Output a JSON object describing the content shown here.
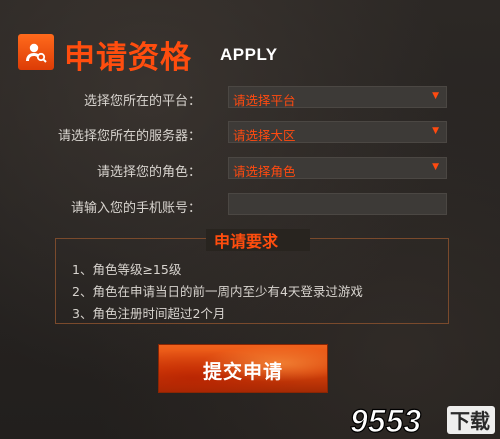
{
  "header": {
    "title": "申请资格",
    "subtitle": "APPLY",
    "icon": "user-search-icon"
  },
  "form": {
    "platform": {
      "label": "选择您所在的平台：",
      "value": "请选择平台"
    },
    "server": {
      "label": "请选择您所在的服务器：",
      "value": "请选择大区"
    },
    "role": {
      "label": "请选择您的角色：",
      "value": "请选择角色"
    },
    "phone": {
      "label": "请输入您的手机账号：",
      "value": ""
    }
  },
  "requirements": {
    "title": "申请要求",
    "items": [
      "1、角色等级≥15级",
      "2、角色在申请当日的前一周内至少有4天登录过游戏",
      "3、角色注册时间超过2个月"
    ]
  },
  "submit_label": "提交申请",
  "watermark": {
    "digits": "9553",
    "text": "下载"
  },
  "colors": {
    "accent": "#ff4d0e",
    "field_bg": "#3d3a37",
    "background": "#262321"
  }
}
